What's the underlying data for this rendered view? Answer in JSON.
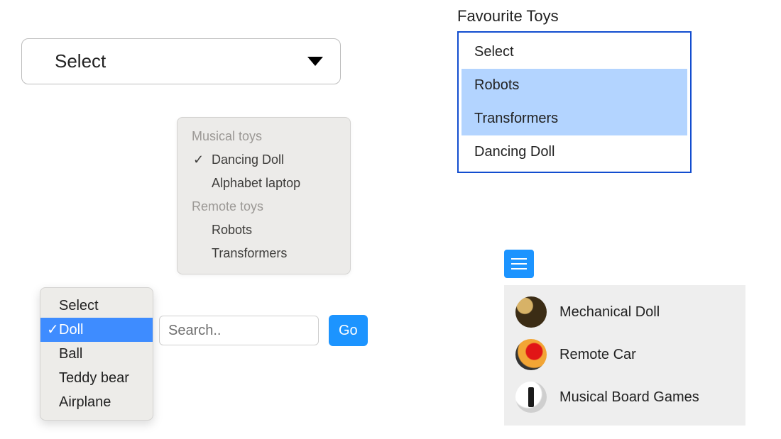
{
  "simple_select": {
    "placeholder": "Select"
  },
  "group_popover": {
    "groups": [
      {
        "label": "Musical toys",
        "options": [
          {
            "label": "Dancing Doll",
            "selected": true
          },
          {
            "label": "Alphabet laptop",
            "selected": false
          }
        ]
      },
      {
        "label": "Remote toys",
        "options": [
          {
            "label": "Robots",
            "selected": false
          },
          {
            "label": "Transformers",
            "selected": false
          }
        ]
      }
    ]
  },
  "select_popover": {
    "items": [
      {
        "label": "Select",
        "selected": false
      },
      {
        "label": "Doll",
        "selected": true
      },
      {
        "label": "Ball",
        "selected": false
      },
      {
        "label": "Teddy bear",
        "selected": false
      },
      {
        "label": "Airplane",
        "selected": false
      }
    ]
  },
  "search": {
    "placeholder": "Search..",
    "go_label": "Go"
  },
  "favourites": {
    "title": "Favourite Toys",
    "items": [
      {
        "label": "Select",
        "selected": false
      },
      {
        "label": "Robots",
        "selected": true
      },
      {
        "label": "Transformers",
        "selected": true
      },
      {
        "label": "Dancing Doll",
        "selected": false
      }
    ]
  },
  "tile_list": {
    "items": [
      {
        "label": "Mechanical Doll"
      },
      {
        "label": "Remote Car"
      },
      {
        "label": "Musical Board Games"
      }
    ]
  }
}
